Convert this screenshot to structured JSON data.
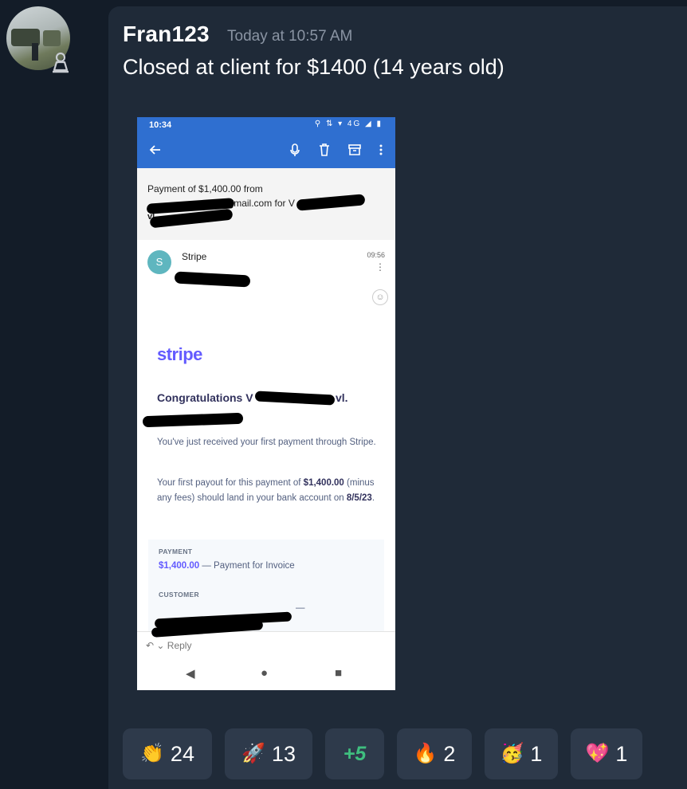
{
  "author": {
    "name": "Fran123",
    "timestamp": "Today at 10:57 AM",
    "role_icon": "pawn-icon"
  },
  "message": {
    "text": "Closed at client for $1400 (14 years old)"
  },
  "screenshot": {
    "status_time": "10:34",
    "status_icons": "⚲ ⇅ ▾ 4G ◢ ▮",
    "app_bar_icons": [
      "back-arrow-icon",
      "microphone-icon",
      "trash-icon",
      "archive-icon",
      "more-vert-icon"
    ],
    "subject_line1": "Payment of $1,400.00 from",
    "subject_line2": "35@gmail.com for V",
    "subject_line3": "vl.",
    "sender_initial": "S",
    "sender_name": "Stripe",
    "mail_time": "09:56",
    "brand": "stripe",
    "brand_color": "#635bff",
    "congrats": "Congratulations V",
    "congrats_end": "vl.",
    "para1": "You've just received your first payment through Stripe.",
    "para2_pre": "Your first payout for this payment of ",
    "para2_amount": "$1,400.00",
    "para2_mid": " (minus any fees) should land in your bank account on ",
    "para2_date": "8/5/23",
    "para2_end": ".",
    "payment_label": "PAYMENT",
    "payment_amount": "$1,400.00",
    "payment_desc": " — Payment for Invoice",
    "customer_label": "CUSTOMER",
    "customer_dash": "—",
    "reply_label": "Reply",
    "nav_back": "◀",
    "nav_home": "●",
    "nav_recent": "■"
  },
  "reactions": [
    {
      "emoji": "👏",
      "count": "24"
    },
    {
      "emoji": "🚀",
      "count": "13"
    },
    {
      "emoji": "",
      "count": "+5"
    },
    {
      "emoji": "🔥",
      "count": "2"
    },
    {
      "emoji": "🥳",
      "count": "1"
    },
    {
      "emoji": "💖",
      "count": "1"
    }
  ]
}
